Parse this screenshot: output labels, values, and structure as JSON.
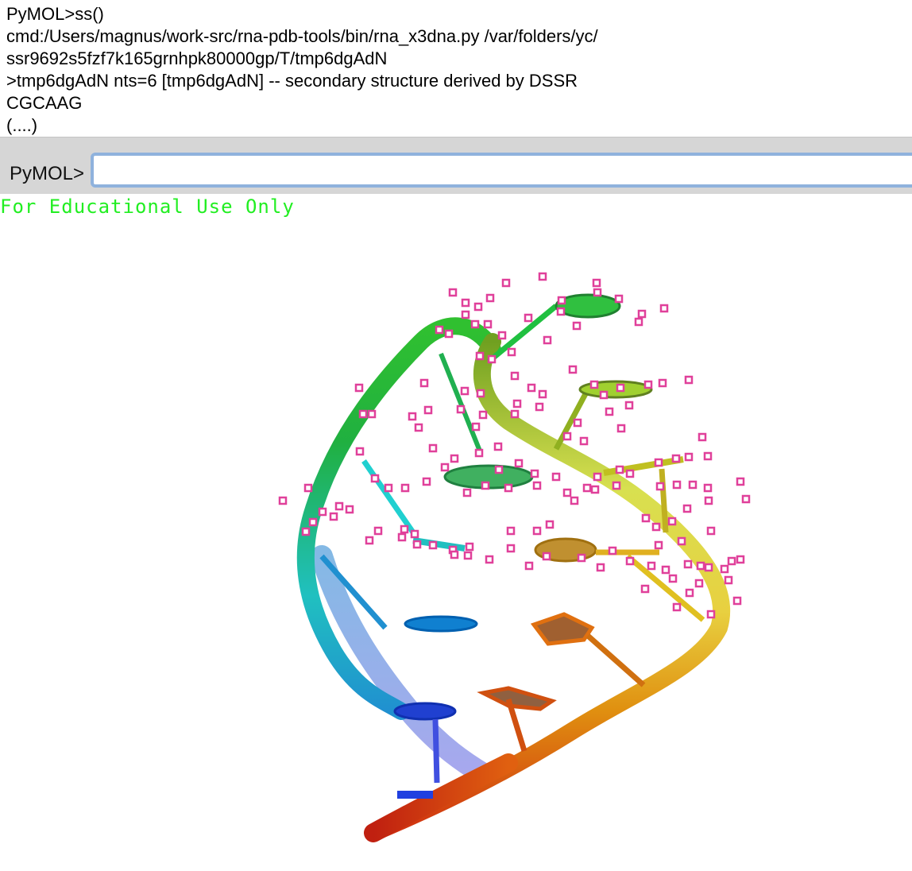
{
  "log": {
    "lines": [
      "PyMOL>ss()",
      "cmd:/Users/magnus/work-src/rna-pdb-tools/bin/rna_x3dna.py /var/folders/yc/",
      "ssr9692s5fzf7k165grnhpk80000gp/T/tmp6dgAdN",
      ">tmp6dgAdN nts=6 [tmp6dgAdN] -- secondary structure derived by DSSR",
      "CGCAAG",
      "(....)"
    ]
  },
  "command": {
    "prompt": "PyMOL>",
    "value": ""
  },
  "viewer": {
    "watermark": "For Educational Use Only",
    "watermark_color": "#22ee22",
    "structure": "RNA cartoon, rainbow colored (blue to red), with selection markers",
    "marker_color": "#e0409a"
  }
}
